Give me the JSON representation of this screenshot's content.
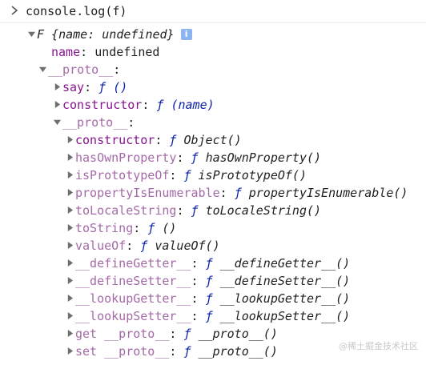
{
  "console": {
    "command": "console.log(f)"
  },
  "object": {
    "summary": "F {name: undefined}",
    "info_badge": "i",
    "props": [
      {
        "key": "name",
        "value": "undefined"
      }
    ],
    "proto_label": "__proto__",
    "proto_items": [
      {
        "key": "say",
        "value": "ƒ ()"
      },
      {
        "key": "constructor",
        "value": "ƒ (name)"
      }
    ],
    "inner_proto_label": "__proto__",
    "inner_proto_items": [
      {
        "key": "constructor",
        "value": "Object()",
        "dim": false
      },
      {
        "key": "hasOwnProperty",
        "value": "hasOwnProperty()",
        "dim": true
      },
      {
        "key": "isPrototypeOf",
        "value": "isPrototypeOf()",
        "dim": true
      },
      {
        "key": "propertyIsEnumerable",
        "value": "propertyIsEnumerable()",
        "dim": true
      },
      {
        "key": "toLocaleString",
        "value": "toLocaleString()",
        "dim": true
      },
      {
        "key": "toString",
        "value": "()",
        "dim": true
      },
      {
        "key": "valueOf",
        "value": "valueOf()",
        "dim": true
      },
      {
        "key": "__defineGetter__",
        "value": "__defineGetter__()",
        "dim": true
      },
      {
        "key": "__defineSetter__",
        "value": "__defineSetter__()",
        "dim": true
      },
      {
        "key": "__lookupGetter__",
        "value": "__lookupGetter__()",
        "dim": true
      },
      {
        "key": "__lookupSetter__",
        "value": "__lookupSetter__()",
        "dim": true
      },
      {
        "key": "get __proto__",
        "value": "__proto__()",
        "dim": true
      },
      {
        "key": "set __proto__",
        "value": "__proto__()",
        "dim": true
      }
    ]
  },
  "function_glyph": "ƒ",
  "watermark": "@稀土掘金技术社区",
  "colors": {
    "key": "#881391",
    "key_dim": "#a56aa8",
    "function": "#0d22aa",
    "badge": "#8cb4ee"
  },
  "icons": {
    "prompt": "chevron-right-icon",
    "expanded": "triangle-down-icon",
    "collapsed": "triangle-right-icon"
  }
}
